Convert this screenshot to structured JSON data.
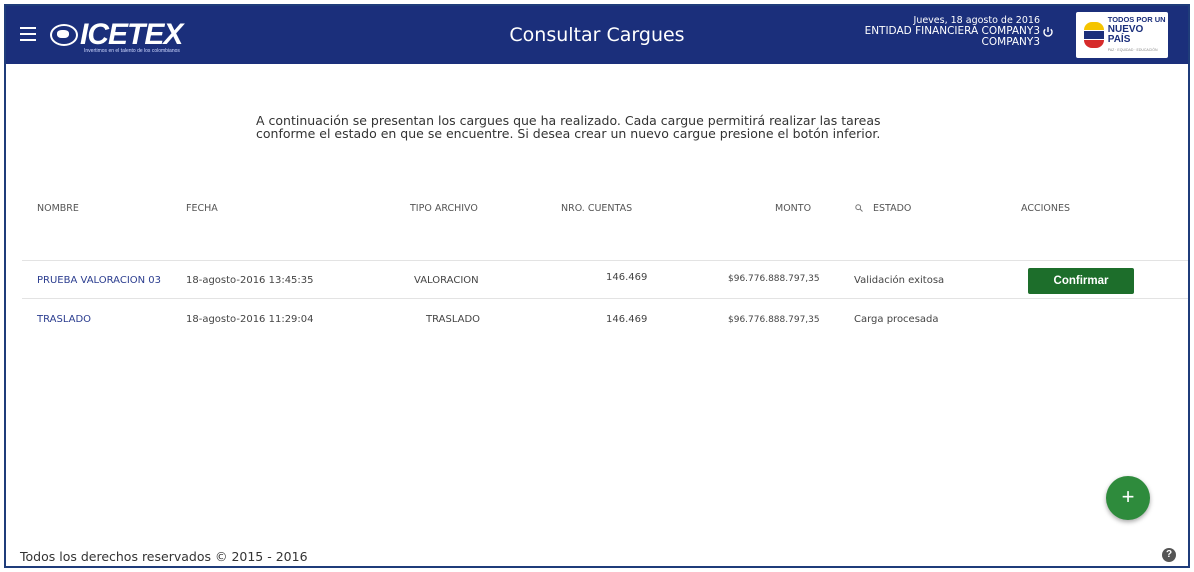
{
  "header": {
    "title": "Consultar Cargues",
    "logo_text": "ICETEX",
    "logo_tagline": "Invertimos en el talento de los colombianos",
    "date": "Jueves, 18 agosto de 2016",
    "entity": "ENTIDAD FINANCIERA COMPANY3",
    "user": "COMPANY3",
    "gov_logo": {
      "line1": "TODOS POR UN",
      "line2": "NUEVO PAÍS",
      "line3": "PAZ · EQUIDAD · EDUCACIÓN"
    },
    "colors": {
      "header_bg": "#1b2f7b"
    }
  },
  "intro": {
    "text": "A continuación se presentan los cargues que ha realizado. Cada cargue permitirá realizar las tareas conforme el estado en que se encuentre. Si desea crear un nuevo cargue presione el botón inferior."
  },
  "table": {
    "headers": {
      "nombre": "NOMBRE",
      "fecha": "FECHA",
      "tipo": "TIPO ARCHIVO",
      "cuentas": "NRO. CUENTAS",
      "monto": "MONTO",
      "estado": "ESTADO",
      "acciones": "ACCIONES"
    },
    "rows": [
      {
        "nombre": "PRUEBA VALORACION 03",
        "fecha": "18-agosto-2016 13:45:35",
        "tipo": "VALORACION",
        "cuentas": "146.469",
        "monto": "$96.776.888.797,35",
        "estado": "Validación exitosa",
        "accion": "Confirmar"
      },
      {
        "nombre": "TRASLADO",
        "fecha": "18-agosto-2016 11:29:04",
        "tipo": "TRASLADO",
        "cuentas": "146.469",
        "monto": "$96.776.888.797,35",
        "estado": "Carga procesada",
        "accion": ""
      }
    ]
  },
  "fab": {
    "icon": "+",
    "color": "#2e8b3c"
  },
  "footer": {
    "text": "Todos los derechos reservados © 2015 - 2016",
    "help": "?"
  },
  "icons": {
    "menu": "hamburger-icon",
    "power": "power-icon",
    "search": "search-icon",
    "help": "help-icon",
    "add": "plus-icon"
  }
}
